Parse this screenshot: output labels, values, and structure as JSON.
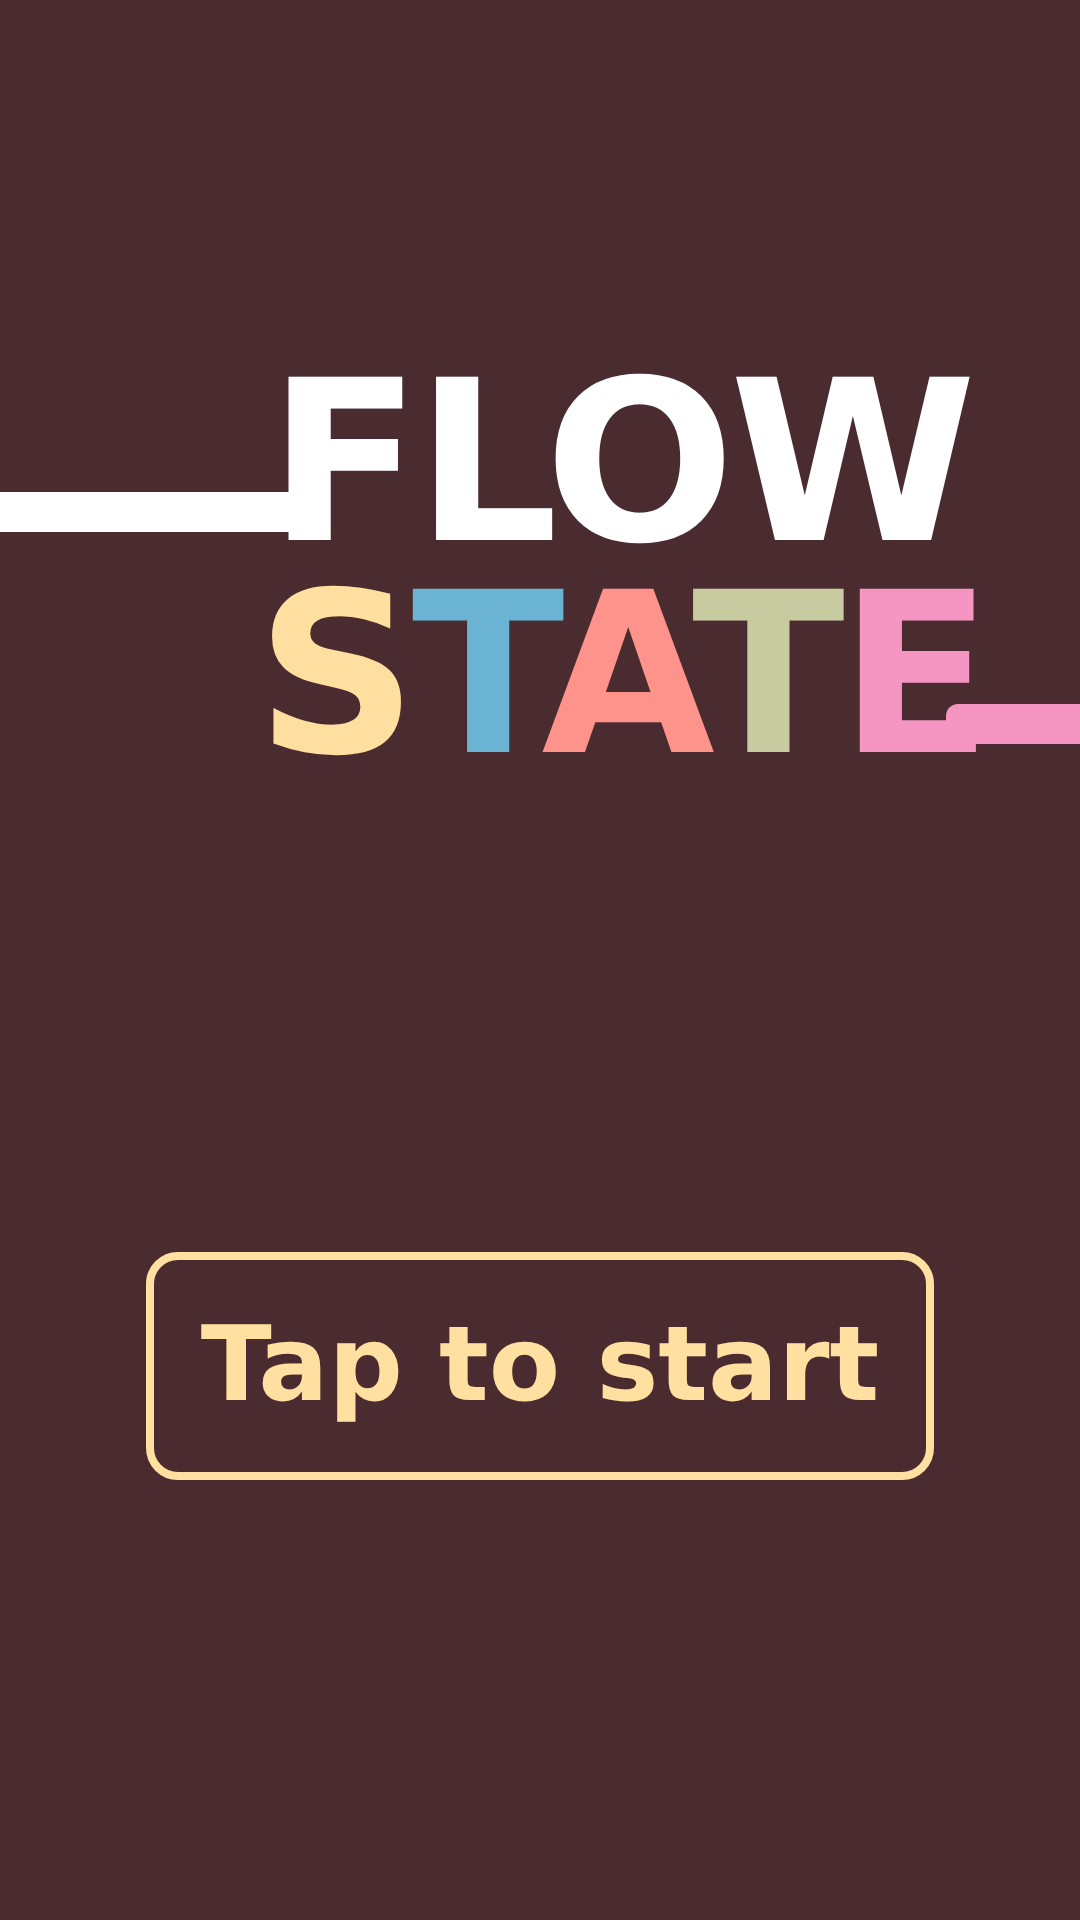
{
  "title": {
    "lines": [
      {
        "letters": [
          {
            "char": "F",
            "color": "#ffffff"
          },
          {
            "char": "L",
            "color": "#ffffff"
          },
          {
            "char": "O",
            "color": "#ffffff"
          },
          {
            "char": "W",
            "color": "#ffffff"
          }
        ]
      },
      {
        "letters": [
          {
            "char": "S",
            "color": "#ffdfa0"
          },
          {
            "char": "T",
            "color": "#6bb3d3"
          },
          {
            "char": "A",
            "color": "#fe938c"
          },
          {
            "char": "T",
            "color": "#c8cba0"
          },
          {
            "char": "E",
            "color": "#f495c2"
          }
        ]
      }
    ]
  },
  "button": {
    "label": "Tap to start"
  }
}
